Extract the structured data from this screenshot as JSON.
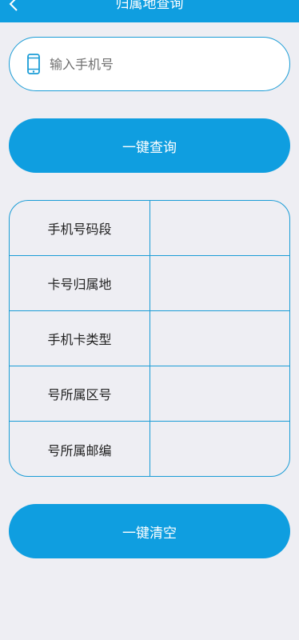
{
  "header": {
    "title": "归属地查询",
    "back_icon": "chevron-left-icon"
  },
  "search": {
    "placeholder": "输入手机号",
    "value": "",
    "icon": "phone-icon"
  },
  "buttons": {
    "query_label": "一键查询",
    "clear_label": "一键清空"
  },
  "results": {
    "rows": [
      {
        "label": "手机号码段",
        "value": ""
      },
      {
        "label": "卡号归属地",
        "value": ""
      },
      {
        "label": "手机卡类型",
        "value": ""
      },
      {
        "label": "号所属区号",
        "value": ""
      },
      {
        "label": "号所属邮编",
        "value": ""
      }
    ]
  },
  "colors": {
    "accent": "#0f9ee0",
    "border": "#1a9cd6",
    "background": "#eeeef3"
  }
}
